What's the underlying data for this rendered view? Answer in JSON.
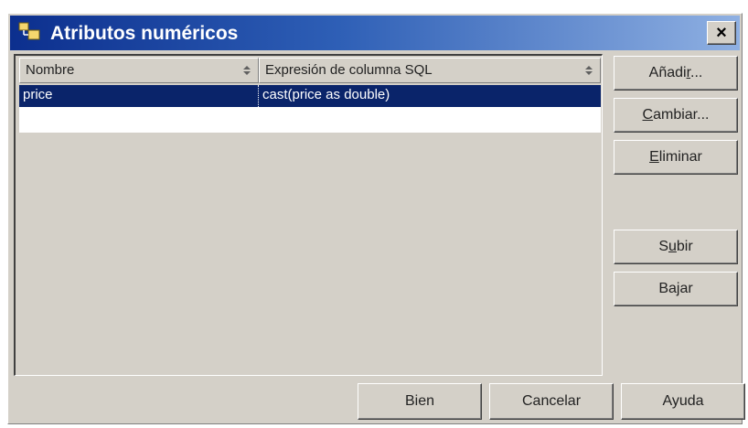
{
  "window": {
    "title": "Atributos numéricos",
    "close_label": "×"
  },
  "table": {
    "columns": [
      "Nombre",
      "Expresión de columna SQL"
    ],
    "rows": [
      {
        "nombre": "price",
        "expresion": "cast(price as double)",
        "selected": true
      }
    ]
  },
  "side_buttons": {
    "add": {
      "pre": "Añadi",
      "u": "r",
      "post": "..."
    },
    "change": {
      "pre": "",
      "u": "C",
      "post": "ambiar..."
    },
    "delete": {
      "pre": "",
      "u": "E",
      "post": "liminar"
    },
    "up": {
      "pre": "S",
      "u": "u",
      "post": "bir"
    },
    "down": {
      "pre": "Ba",
      "u": "j",
      "post": "ar"
    }
  },
  "footer": {
    "ok_label": "Bien",
    "cancel_label": "Cancelar",
    "help_label": "Ayuda"
  },
  "colors": {
    "selection": "#0a246a",
    "dialog_bg": "#d4d0c8",
    "title_gradient_start": "#0c2f8e",
    "title_gradient_end": "#8fb0e2"
  }
}
